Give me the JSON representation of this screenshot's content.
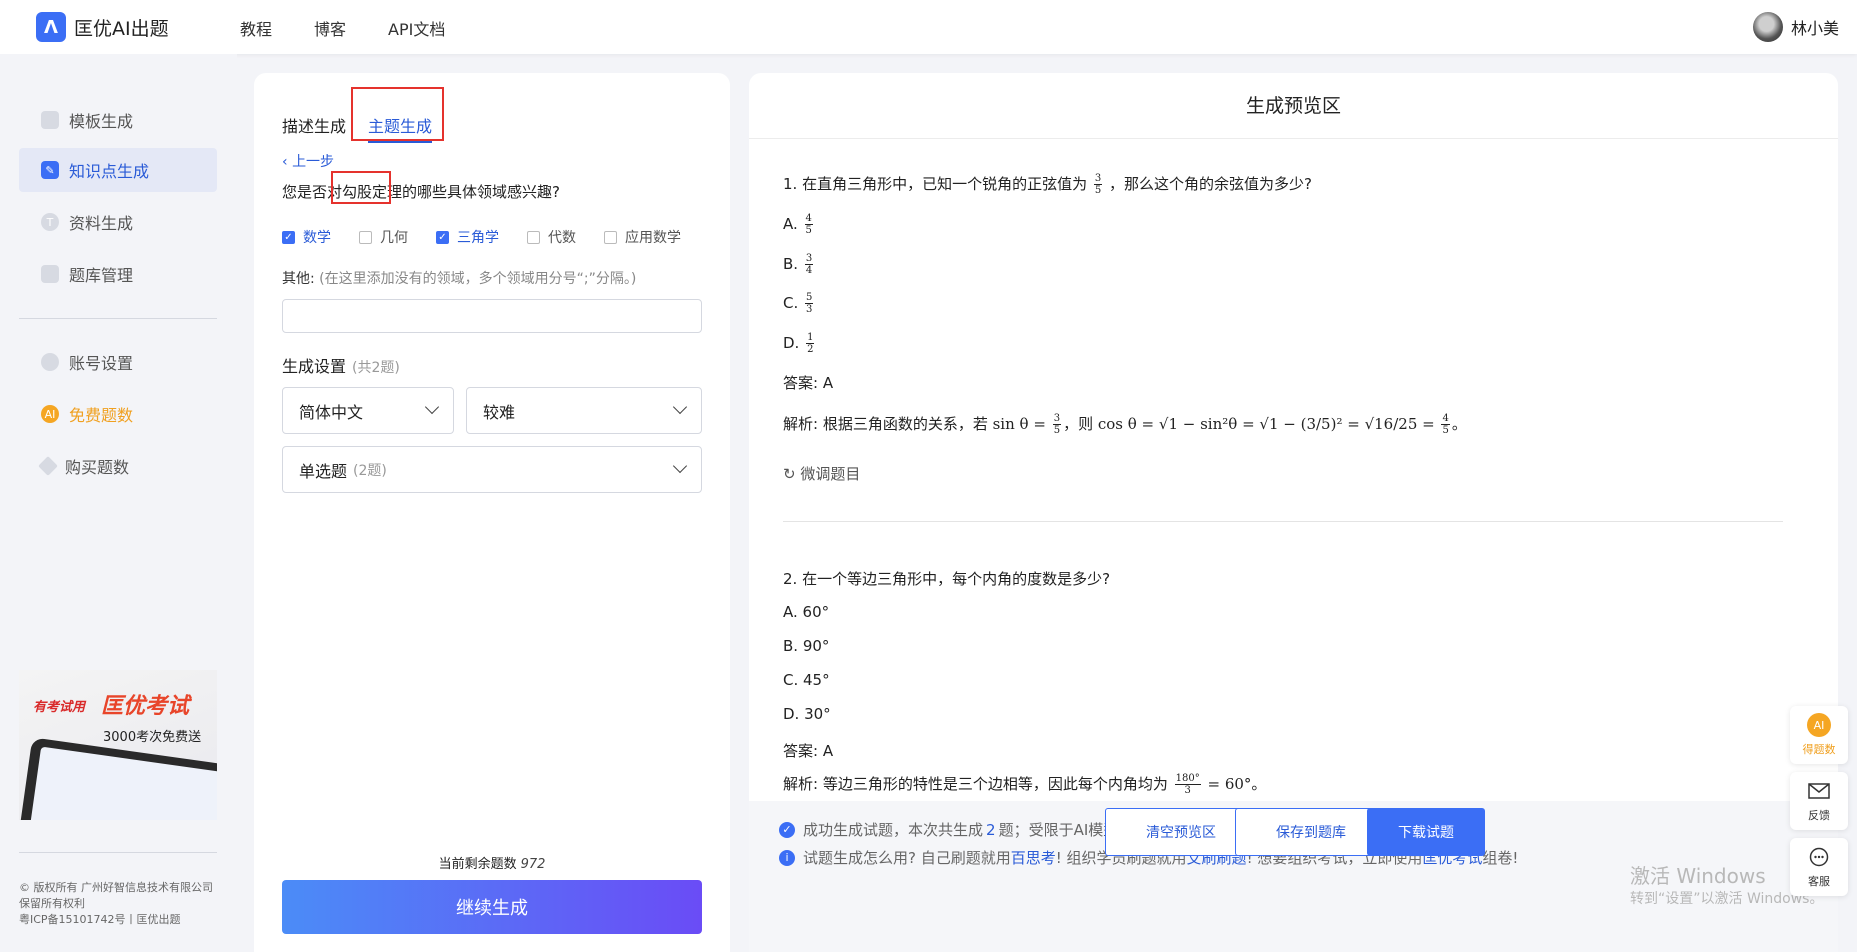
{
  "app": {
    "logo_mark": "Λ",
    "name": "匡优AI出题"
  },
  "topnav": {
    "links": [
      "教程",
      "博客",
      "API文档"
    ]
  },
  "user": {
    "name": "林小美"
  },
  "sidebar": {
    "items": [
      {
        "label": "模板生成",
        "icon": "template-icon"
      },
      {
        "label": "知识点生成",
        "icon": "knowledge-icon"
      },
      {
        "label": "资料生成",
        "icon": "material-icon"
      },
      {
        "label": "题库管理",
        "icon": "bank-icon"
      },
      {
        "label": "账号设置",
        "icon": "account-icon"
      },
      {
        "label": "免费题数",
        "icon": "ai-coin-icon",
        "icon_text": "AI"
      },
      {
        "label": "购买题数",
        "icon": "diamond-icon"
      }
    ],
    "promo": {
      "line1": "有考试用",
      "line2": "匡优考试",
      "line3": "3000考次免费送"
    },
    "footer": [
      "© 版权所有 广州好智信息技术有限公司",
      "保留所有权利",
      "粤ICP备15101742号丨匡优出题"
    ]
  },
  "left": {
    "tabs": [
      "描述生成",
      "主题生成"
    ],
    "back": "上一步",
    "question_prefix": "您是否对",
    "question_topic": "勾股定理",
    "question_suffix": "的哪些具体领域感兴趣?",
    "options": [
      {
        "label": "数学",
        "checked": true
      },
      {
        "label": "几何",
        "checked": false
      },
      {
        "label": "三角学",
        "checked": true
      },
      {
        "label": "代数",
        "checked": false
      },
      {
        "label": "应用数学",
        "checked": false
      }
    ],
    "other_label": "其他:",
    "other_hint": "(在这里添加没有的领域，多个领域用分号“;”分隔。)",
    "gen_title": "生成设置",
    "gen_count": "(共2题)",
    "language": "简体中文",
    "difficulty": "较难",
    "qtype": "单选题",
    "qtype_count": "(2题)",
    "remain_label": "当前剩余题数",
    "remain_value": "972",
    "continue_button": "继续生成"
  },
  "preview": {
    "title": "生成预览区",
    "q1": {
      "stem_a": "1. 在直角三角形中，已知一个锐角的正弦值为",
      "stem_b": "，那么这个角的余弦值为多少?",
      "sin_num": "3",
      "sin_den": "5",
      "options": [
        {
          "key": "A.",
          "num": "4",
          "den": "5"
        },
        {
          "key": "B.",
          "num": "3",
          "den": "4"
        },
        {
          "key": "C.",
          "num": "5",
          "den": "3"
        },
        {
          "key": "D.",
          "num": "1",
          "den": "2"
        }
      ],
      "answer": "答案: A",
      "analysis_a": "解析: 根据三角函数的关系，若",
      "sin_expr": "sin θ =",
      "analysis_b": "，则",
      "cos_expr": "cos θ = √1 − sin²θ = √1 − (3/5)² = √16/25 =",
      "end": "。"
    },
    "tune": "微调题目",
    "q2": {
      "stem": "2. 在一个等边三角形中，每个内角的度数是多少?",
      "options": [
        "A. 60°",
        "B. 90°",
        "C. 45°",
        "D. 30°"
      ],
      "answer": "答案: A",
      "analysis_a": "解析: 等边三角形的特性是三个边相等，因此每个内角均为",
      "frac_num": "180°",
      "frac_den": "3",
      "analysis_b": "= 60°",
      "end": "。"
    },
    "notice1_a": "成功生成试题，本次共生成",
    "notice1_count": "2",
    "notice1_b": "题；受限于AI模型，请自行核对生成的试题是否正确。",
    "notice2_a": "试题生成怎么用? 自己刷题就用",
    "notice2_link1": "百思考",
    "notice2_b": "! 组织学员刷题就用",
    "notice2_link2": "艾刷刷题",
    "notice2_c": "!  想要组织考试，立即使用",
    "notice2_link3": "匡优考试",
    "notice2_d": "组卷!",
    "buttons": {
      "clear": "清空预览区",
      "save": "保存到题库",
      "download": "下载试题"
    }
  },
  "floats": {
    "earn": "得题数",
    "feedback": "反馈",
    "service": "客服",
    "ai": "AI"
  },
  "watermark": {
    "line1": "激活 Windows",
    "line2": "转到“设置”以激活 Windows。"
  },
  "colors": {
    "primary": "#3b6ef5",
    "highlight_box": "#e5322d",
    "orange": "#f5a623"
  }
}
